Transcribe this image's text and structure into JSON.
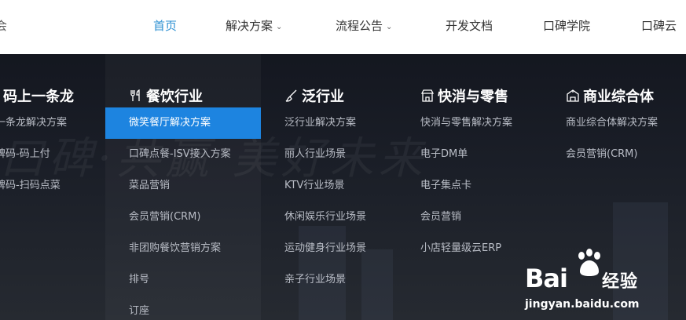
{
  "nav": {
    "logo_fragment": "会",
    "items": [
      {
        "label": "首页",
        "active": true
      },
      {
        "label": "解决方案",
        "dropdown": true
      },
      {
        "label": "流程公告",
        "dropdown": true
      },
      {
        "label": "开发文档"
      },
      {
        "label": "口碑学院"
      },
      {
        "label": "口碑云"
      }
    ],
    "active_color": "#2b8fd2"
  },
  "menu": {
    "background_slogan": "口碑·共赢 美好未来",
    "columns": [
      {
        "title": "码上一条龙",
        "icon": "none",
        "items": [
          "一条龙解决方案",
          "碑码-码上付",
          "碑码-扫码点菜"
        ]
      },
      {
        "title": "餐饮行业",
        "icon": "fork-knife-icon",
        "items": [
          "微笑餐厅解决方案",
          "口碑点餐-ISV接入方案",
          "菜品营销",
          "会员营销(CRM)",
          "非团购餐饮营销方案",
          "排号",
          "订座"
        ],
        "selected_index": 0
      },
      {
        "title": "泛行业",
        "icon": "brush-icon",
        "items": [
          "泛行业解决方案",
          "丽人行业场景",
          "KTV行业场景",
          "休闲娱乐行业场景",
          "运动健身行业场景",
          "亲子行业场景"
        ]
      },
      {
        "title": "快消与零售",
        "icon": "store-icon",
        "items": [
          "快消与零售解决方案",
          "电子DM单",
          "电子集点卡",
          "会员营销",
          "小店轻量级云ERP"
        ]
      },
      {
        "title": "商业综合体",
        "icon": "building-icon",
        "items": [
          "商业综合体解决方案",
          "会员营销(CRM)"
        ]
      }
    ],
    "selected_color": "#1d84e0"
  },
  "watermark": {
    "brand_left": "Bai",
    "brand_right": "经验",
    "url": "jingyan.baidu.com"
  }
}
